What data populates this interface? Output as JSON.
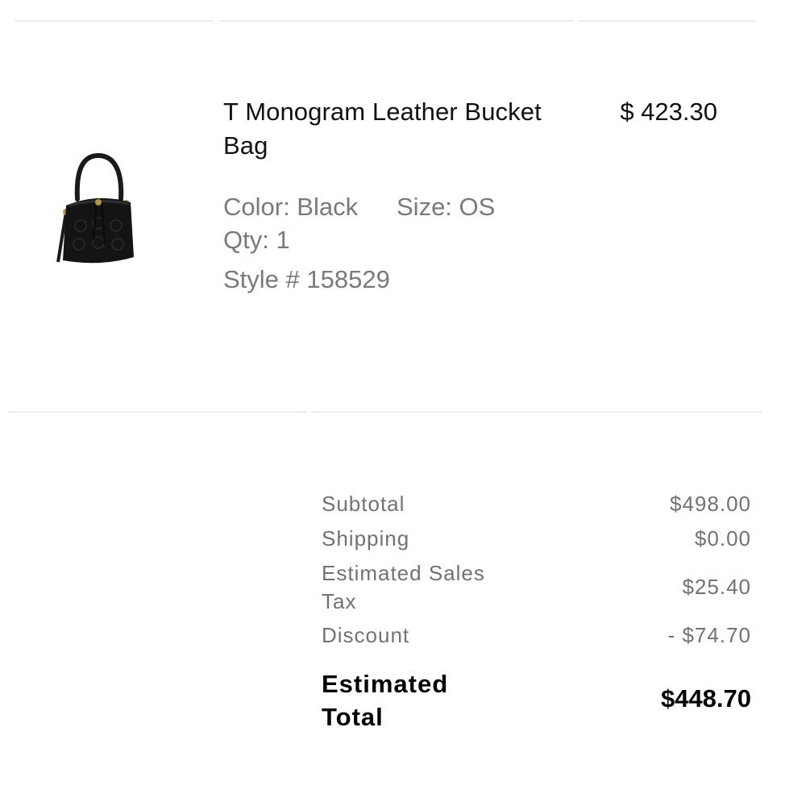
{
  "item": {
    "title": "T Monogram Leather Bucket Bag",
    "price": "$ 423.30",
    "color": "Color: Black",
    "size": "Size: OS",
    "qty": "Qty: 1",
    "style": "Style # 158529",
    "image_icon": "bucket-bag-product-image"
  },
  "summary": {
    "subtotal_label": "Subtotal",
    "subtotal_value": "$498.00",
    "shipping_label": "Shipping",
    "shipping_value": "$0.00",
    "tax_label": "Estimated Sales Tax",
    "tax_value": "$25.40",
    "discount_label": "Discount",
    "discount_value": "- $74.70",
    "total_label": "Estimated Total",
    "total_value": "$448.70"
  },
  "colors": {
    "primary_text": "#111111",
    "secondary_text": "#7a7a7a",
    "divider": "#ececec"
  }
}
